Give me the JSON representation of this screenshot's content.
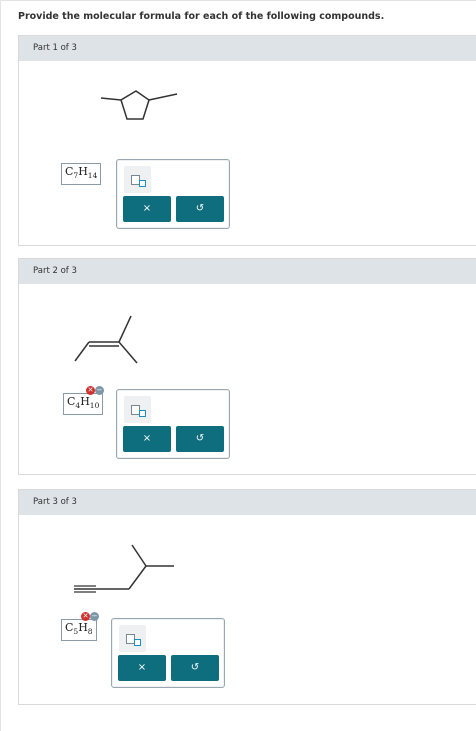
{
  "prompt": "Provide the molecular formula for each of the following compounds.",
  "parts": [
    {
      "title": "Part 1 of 3",
      "formula": {
        "c": "7",
        "h": "14"
      },
      "clear_label": "×",
      "reset_label": "↺"
    },
    {
      "title": "Part 2 of 3",
      "formula": {
        "c": "4",
        "h": "10"
      },
      "clear_label": "×",
      "reset_label": "↺"
    },
    {
      "title": "Part 3 of 3",
      "formula": {
        "c": "5",
        "h": "8"
      },
      "clear_label": "×",
      "reset_label": "↺"
    }
  ],
  "colors": {
    "header_bg": "#dde3e6",
    "button_bg": "#0f6e7d",
    "error_badge": "#d0312d"
  }
}
